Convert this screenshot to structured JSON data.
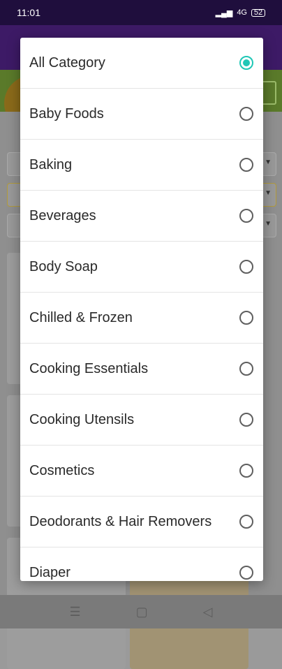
{
  "status_bar": {
    "time": "11:01",
    "signal": "▂▄▆",
    "network": "4G",
    "battery": "52"
  },
  "dialog": {
    "options": [
      {
        "label": "All Category",
        "selected": true
      },
      {
        "label": "Baby Foods",
        "selected": false
      },
      {
        "label": "Baking",
        "selected": false
      },
      {
        "label": "Beverages",
        "selected": false
      },
      {
        "label": "Body Soap",
        "selected": false
      },
      {
        "label": "Chilled & Frozen",
        "selected": false
      },
      {
        "label": "Cooking Essentials",
        "selected": false
      },
      {
        "label": "Cooking Utensils",
        "selected": false
      },
      {
        "label": "Cosmetics",
        "selected": false
      },
      {
        "label": "Deodorants & Hair Removers",
        "selected": false
      },
      {
        "label": "Diaper",
        "selected": false
      }
    ]
  },
  "nav_bar": {
    "menu_icon": "☰",
    "home_icon": "▢",
    "back_icon": "◁"
  },
  "colors": {
    "accent": "#1fc7b6",
    "app_bar": "#3d1a66",
    "status_bar": "#1f0e3d"
  }
}
